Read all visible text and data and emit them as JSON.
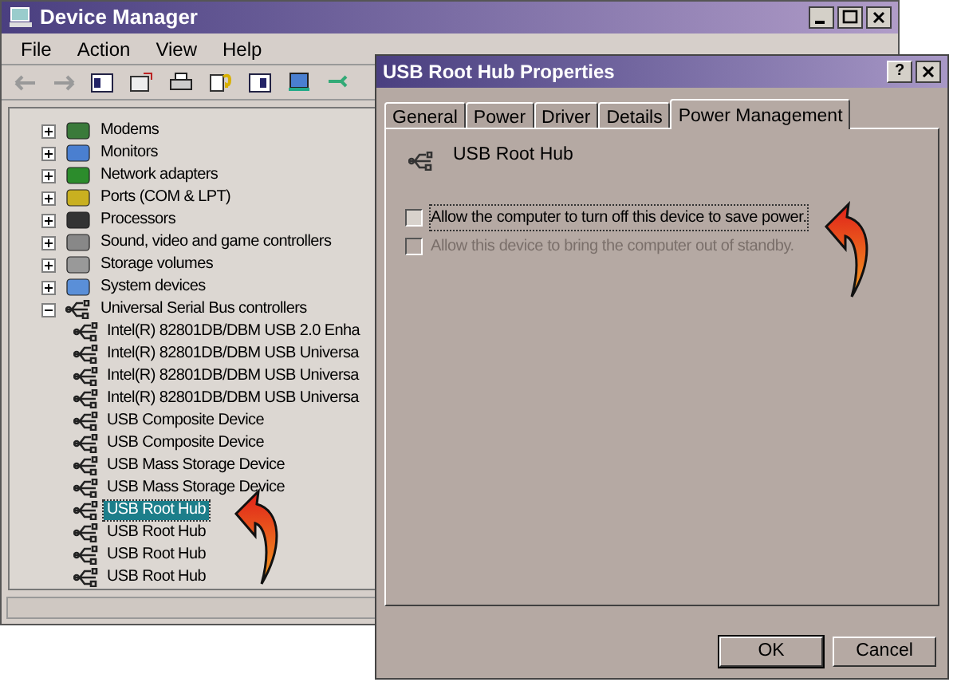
{
  "device_manager": {
    "title": "Device Manager",
    "menu": [
      "File",
      "Action",
      "View",
      "Help"
    ],
    "tree": [
      {
        "label": "Modems",
        "expanded": false
      },
      {
        "label": "Monitors",
        "expanded": false
      },
      {
        "label": "Network adapters",
        "expanded": false
      },
      {
        "label": "Ports (COM & LPT)",
        "expanded": false
      },
      {
        "label": "Processors",
        "expanded": false
      },
      {
        "label": "Sound, video and game controllers",
        "expanded": false
      },
      {
        "label": "Storage volumes",
        "expanded": false
      },
      {
        "label": "System devices",
        "expanded": false
      },
      {
        "label": "Universal Serial Bus controllers",
        "expanded": true,
        "children": [
          {
            "label": "Intel(R) 82801DB/DBM USB 2.0 Enha",
            "selected": false
          },
          {
            "label": "Intel(R) 82801DB/DBM USB Universa",
            "selected": false
          },
          {
            "label": "Intel(R) 82801DB/DBM USB Universa",
            "selected": false
          },
          {
            "label": "Intel(R) 82801DB/DBM USB Universa",
            "selected": false
          },
          {
            "label": "USB Composite Device",
            "selected": false
          },
          {
            "label": "USB Composite Device",
            "selected": false
          },
          {
            "label": "USB Mass Storage Device",
            "selected": false
          },
          {
            "label": "USB Mass Storage Device",
            "selected": false
          },
          {
            "label": "USB Root Hub",
            "selected": true
          },
          {
            "label": "USB Root Hub",
            "selected": false
          },
          {
            "label": "USB Root Hub",
            "selected": false
          },
          {
            "label": "USB Root Hub",
            "selected": false
          }
        ]
      }
    ]
  },
  "dialog": {
    "title": "USB Root Hub Properties",
    "help": "?",
    "tabs": [
      {
        "label": "General",
        "selected": false
      },
      {
        "label": "Power",
        "selected": false
      },
      {
        "label": "Driver",
        "selected": false
      },
      {
        "label": "Details",
        "selected": false
      },
      {
        "label": "Power Management",
        "selected": true
      }
    ],
    "device_name": "USB Root Hub",
    "options": [
      {
        "label": "Allow the computer to turn off this device to save power.",
        "checked": false,
        "disabled": false
      },
      {
        "label": "Allow this device to bring the computer out of standby.",
        "checked": false,
        "disabled": true
      }
    ],
    "buttons": [
      "OK",
      "Cancel"
    ]
  }
}
